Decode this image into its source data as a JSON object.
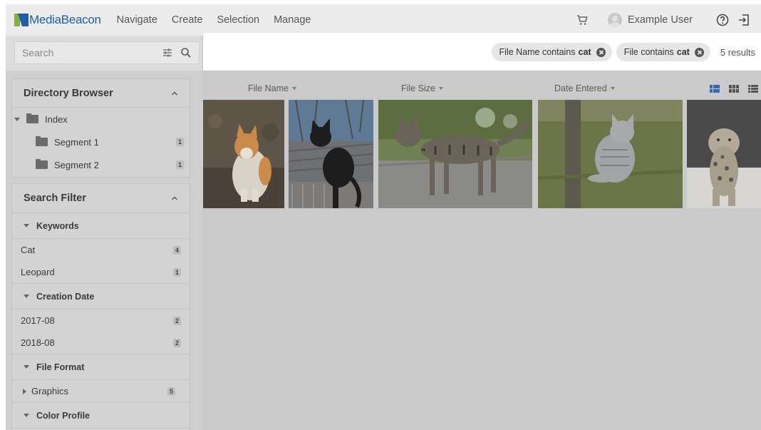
{
  "app": {
    "brand": "MediaBeacon",
    "nav": [
      "Navigate",
      "Create",
      "Selection",
      "Manage"
    ],
    "user_name": "Example User"
  },
  "search": {
    "placeholder": "Search",
    "chips": [
      {
        "prefix": "File Name contains",
        "term": "cat"
      },
      {
        "prefix": "File contains",
        "term": "cat"
      }
    ],
    "results": "5 results"
  },
  "directory_browser": {
    "title": "Directory Browser",
    "root": "Index",
    "children": [
      {
        "label": "Segment 1",
        "count": "1"
      },
      {
        "label": "Segment 2",
        "count": "1"
      }
    ]
  },
  "search_filter": {
    "title": "Search Filter",
    "sections": [
      {
        "title": "Keywords",
        "items": [
          {
            "label": "Cat",
            "count": "4"
          },
          {
            "label": "Leopard",
            "count": "1"
          }
        ]
      },
      {
        "title": "Creation Date",
        "items": [
          {
            "label": "2017-08",
            "count": "2"
          },
          {
            "label": "2018-08",
            "count": "2"
          }
        ]
      },
      {
        "title": "File Format",
        "items": [
          {
            "label": "Graphics",
            "count": "5"
          }
        ]
      },
      {
        "title": "Color Profile",
        "items": []
      }
    ]
  },
  "columns": [
    "File Name",
    "File Size",
    "Date Entered"
  ],
  "thumbnails": [
    {
      "subject": "orange-white-cat"
    },
    {
      "subject": "black-cat"
    },
    {
      "subject": "tabby-cat-walking"
    },
    {
      "subject": "grey-cat-sitting"
    },
    {
      "subject": "snow-leopard"
    }
  ],
  "icons": [
    "cart-icon",
    "avatar-icon",
    "help-icon",
    "logout-icon",
    "filter-settings-icon",
    "search-icon",
    "folder-icon",
    "grid-large-icon",
    "grid-small-icon",
    "list-view-icon"
  ],
  "colors": {
    "brand_blue": "#1f5ea8",
    "brand_green": "#7fb241",
    "active_view": "#2f6db8"
  }
}
